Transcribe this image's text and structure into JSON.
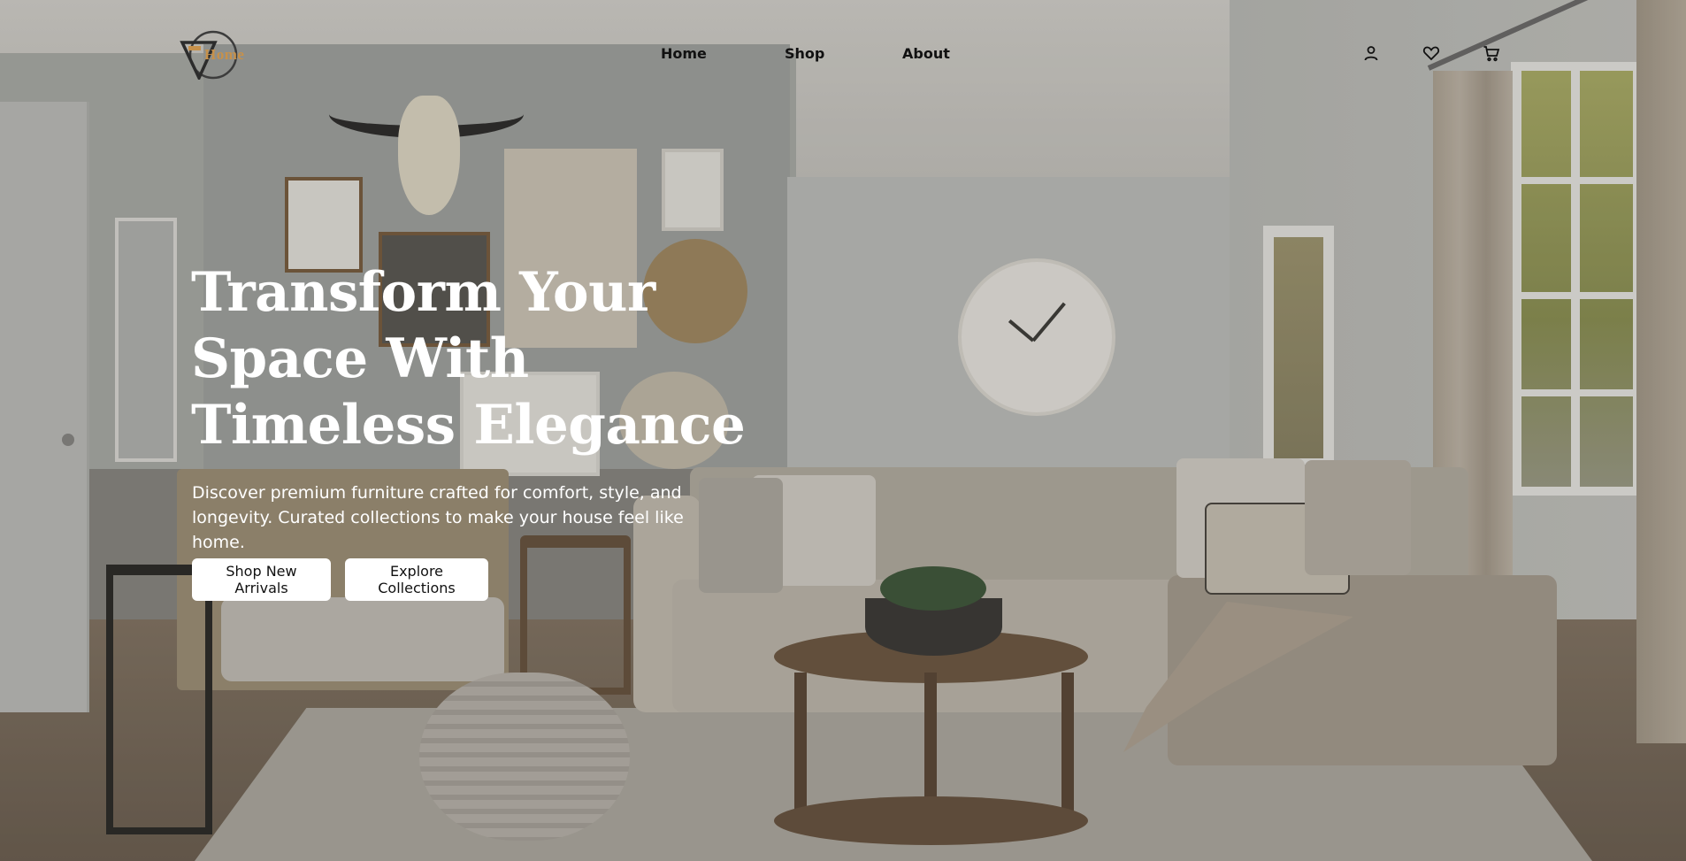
{
  "brand": {
    "logo_text": "Home"
  },
  "nav": {
    "items": [
      {
        "label": "Home"
      },
      {
        "label": "Shop"
      },
      {
        "label": "About"
      }
    ]
  },
  "header_icons": [
    "user-icon",
    "heart-icon",
    "cart-icon"
  ],
  "hero": {
    "title": "Transform Your Space With Timeless Elegance",
    "subtitle": "Discover premium furniture crafted for comfort, style, and longevity. Curated collections to make your house feel like home.",
    "primary_cta": "Shop New Arrivals",
    "secondary_cta": "Explore Collections"
  },
  "colors": {
    "logo_accent": "#c7914a",
    "hero_text": "#ffffff",
    "nav_text": "#111111",
    "button_bg": "#ffffff"
  }
}
